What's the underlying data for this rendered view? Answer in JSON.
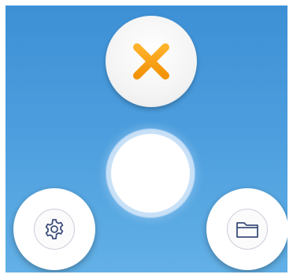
{
  "controls": {
    "close": {
      "icon": "close-x-icon",
      "accent": "#f5a00f"
    },
    "capture": {
      "icon": "shutter-button"
    },
    "settings": {
      "icon": "gear-icon"
    },
    "gallery": {
      "icon": "folder-icon"
    }
  },
  "colors": {
    "background_top": "#3e90d6",
    "background_bottom": "#62b0e6",
    "icon_stroke": "#3d4e7a"
  }
}
